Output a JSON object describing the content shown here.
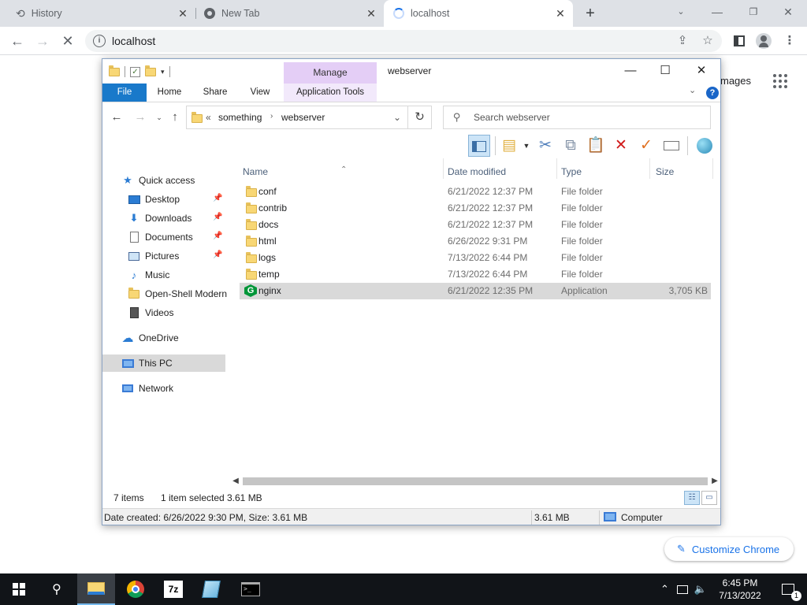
{
  "browser": {
    "tabs": [
      {
        "title": "History"
      },
      {
        "title": "New Tab"
      },
      {
        "title": "localhost"
      }
    ],
    "url": "localhost",
    "ntp": {
      "images_link": "mages",
      "customize_label": "Customize Chrome"
    }
  },
  "explorer": {
    "window_title": "webserver",
    "manage_tab": "Manage",
    "ribbon_tabs": [
      "File",
      "Home",
      "Share",
      "View",
      "Application Tools"
    ],
    "address": {
      "overflow": "«",
      "crumbs": [
        "something",
        "webserver"
      ]
    },
    "search_placeholder": "Search webserver",
    "nav": [
      {
        "label": "Quick access",
        "icon": "star-icon"
      },
      {
        "label": "Desktop",
        "icon": "desktop-icon",
        "pinned": true
      },
      {
        "label": "Downloads",
        "icon": "download-icon",
        "pinned": true
      },
      {
        "label": "Documents",
        "icon": "documents-icon",
        "pinned": true
      },
      {
        "label": "Pictures",
        "icon": "pictures-icon",
        "pinned": true
      },
      {
        "label": "Music",
        "icon": "music-icon"
      },
      {
        "label": "Open-Shell Modern",
        "icon": "folder-icon"
      },
      {
        "label": "Videos",
        "icon": "videos-icon"
      },
      {
        "label": "OneDrive",
        "icon": "cloud-icon"
      },
      {
        "label": "This PC",
        "icon": "computer-icon",
        "selected": true
      },
      {
        "label": "Network",
        "icon": "network-icon"
      }
    ],
    "columns": [
      "Name",
      "Date modified",
      "Type",
      "Size"
    ],
    "files": [
      {
        "name": "conf",
        "date": "6/21/2022 12:37 PM",
        "type": "File folder",
        "size": ""
      },
      {
        "name": "contrib",
        "date": "6/21/2022 12:37 PM",
        "type": "File folder",
        "size": ""
      },
      {
        "name": "docs",
        "date": "6/21/2022 12:37 PM",
        "type": "File folder",
        "size": ""
      },
      {
        "name": "html",
        "date": "6/26/2022 9:31 PM",
        "type": "File folder",
        "size": ""
      },
      {
        "name": "logs",
        "date": "7/13/2022 6:44 PM",
        "type": "File folder",
        "size": ""
      },
      {
        "name": "temp",
        "date": "7/13/2022 6:44 PM",
        "type": "File folder",
        "size": ""
      },
      {
        "name": "nginx",
        "date": "6/21/2022 12:35 PM",
        "type": "Application",
        "size": "3,705 KB",
        "selected": true
      }
    ],
    "status": {
      "count": "7 items",
      "selection": "1 item selected",
      "size": "3.61 MB"
    },
    "details": {
      "info": "Date created: 6/26/2022 9:30 PM, Size: 3.61 MB",
      "size": "3.61 MB",
      "location": "Computer"
    }
  },
  "taskbar": {
    "apps": [
      "File Explorer",
      "Google Chrome",
      "7-Zip",
      "Notepad",
      "Command Prompt"
    ],
    "seven_zip": "7z",
    "time": "6:45 PM",
    "date": "7/13/2022",
    "notifications": "1"
  }
}
